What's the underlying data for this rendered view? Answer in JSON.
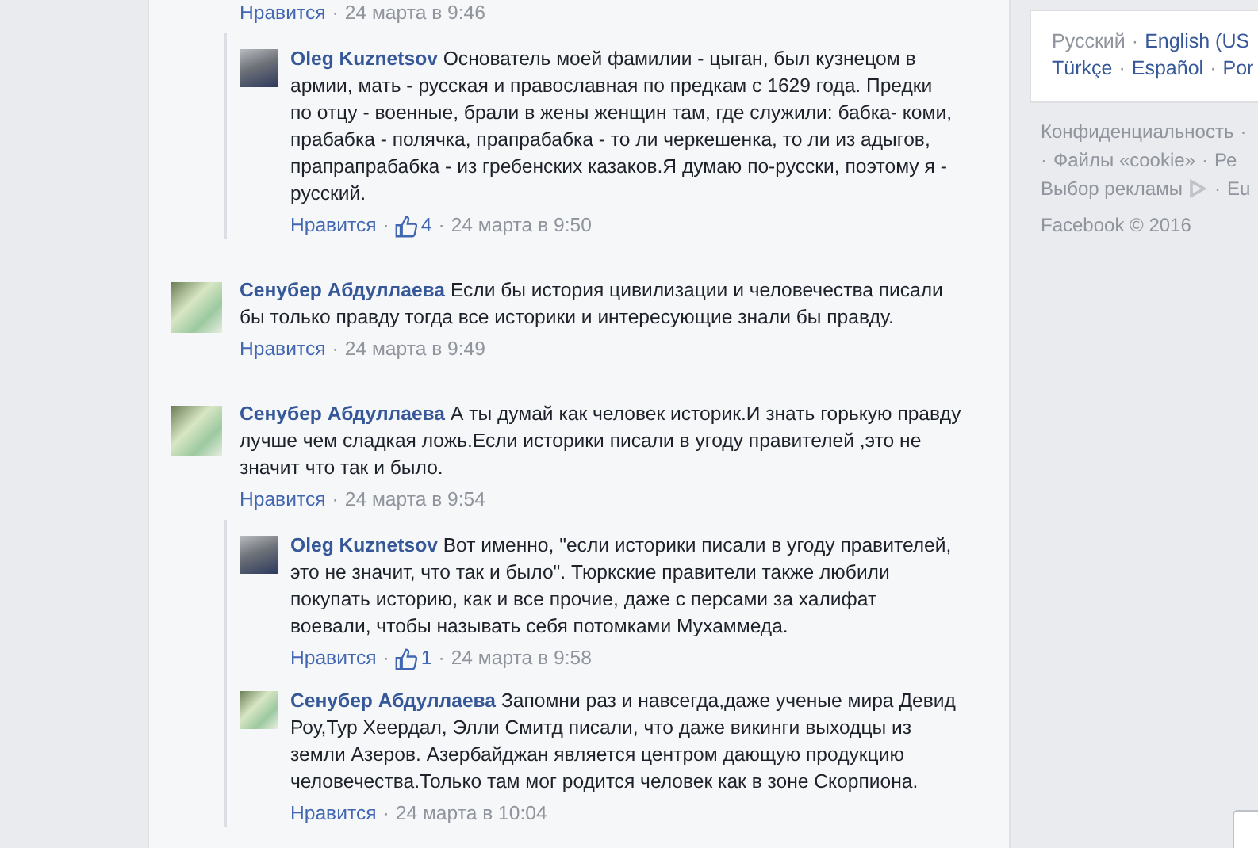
{
  "separator": "·",
  "threads": [
    {
      "comment": {
        "kind": "actions_only",
        "like": "Нравится",
        "time": "24 марта в 9:46"
      },
      "replies": [
        {
          "author": "Oleg Kuznetsov",
          "kind": "photo",
          "text": "Основатель моей фамилии - цыган, был кузнецом в армии, мать - русская и православная по предкам с 1629 года. Предки по отцу - военные, брали в жены женщин там, где служили: бабка- коми, прабабка - полячка, прапрабабка - то ли черкешенка, то ли из адыгов, прапрапрабабка - из гребенских казаков.Я думаю по-русски, поэтому я - русский.",
          "like": "Нравится",
          "likes": "4",
          "time": "24 марта в 9:50"
        }
      ]
    },
    {
      "comment": {
        "author": "Сенубер Абдуллаева",
        "kind": "picture",
        "text": "Если бы история цивилизации и человечества писали бы только правду тогда все историки и интересующие знали бы правду.",
        "like": "Нравится",
        "time": "24 марта в 9:49"
      }
    },
    {
      "comment": {
        "author": "Сенубер Абдуллаева",
        "kind": "picture",
        "text": "А ты думай как человек историк.И знать горькую правду лучше чем сладкая ложь.Если историки писали в угоду правителей ,это не значит что так и было.",
        "like": "Нравится",
        "time": "24 марта в 9:54"
      },
      "replies": [
        {
          "author": "Oleg Kuznetsov",
          "kind": "photo",
          "text": "Вот именно, \"если историки писали в угоду правителей, это не значит, что так и было\". Тюркские правители также любили покупать историю, как и все прочие, даже с персами за халифат воевали, чтобы называть себя потомками Мухаммеда.",
          "like": "Нравится",
          "likes": "1",
          "time": "24 марта в 9:58"
        },
        {
          "author": "Сенубер Абдуллаева",
          "kind": "picture",
          "text": "Запомни раз и навсегда,даже ученые мира Девид Роу,Тур Хеердал, Элли Смитд писали, что даже викинги выходцы из земли Азеров. Азербайджан является центром дающую продукцию человечества.Только там мог родится человек как в зоне Скорпиона.",
          "like": "Нравится",
          "time": "24 марта в 10:04"
        }
      ]
    }
  ],
  "languages": [
    {
      "label": "Русский",
      "selected": true
    },
    {
      "label": "English (US",
      "selected": false
    },
    {
      "label": "Türkçe",
      "selected": false
    },
    {
      "label": "Español",
      "selected": false
    },
    {
      "label": "Por",
      "selected": false
    }
  ],
  "footer_links": [
    [
      "Конфиденциальность",
      "·"
    ],
    [
      "·",
      "Файлы «cookie»",
      "·",
      "Ре"
    ],
    [
      "Выбор рекламы",
      "·",
      "Eu"
    ]
  ],
  "copyright": "Facebook © 2016"
}
